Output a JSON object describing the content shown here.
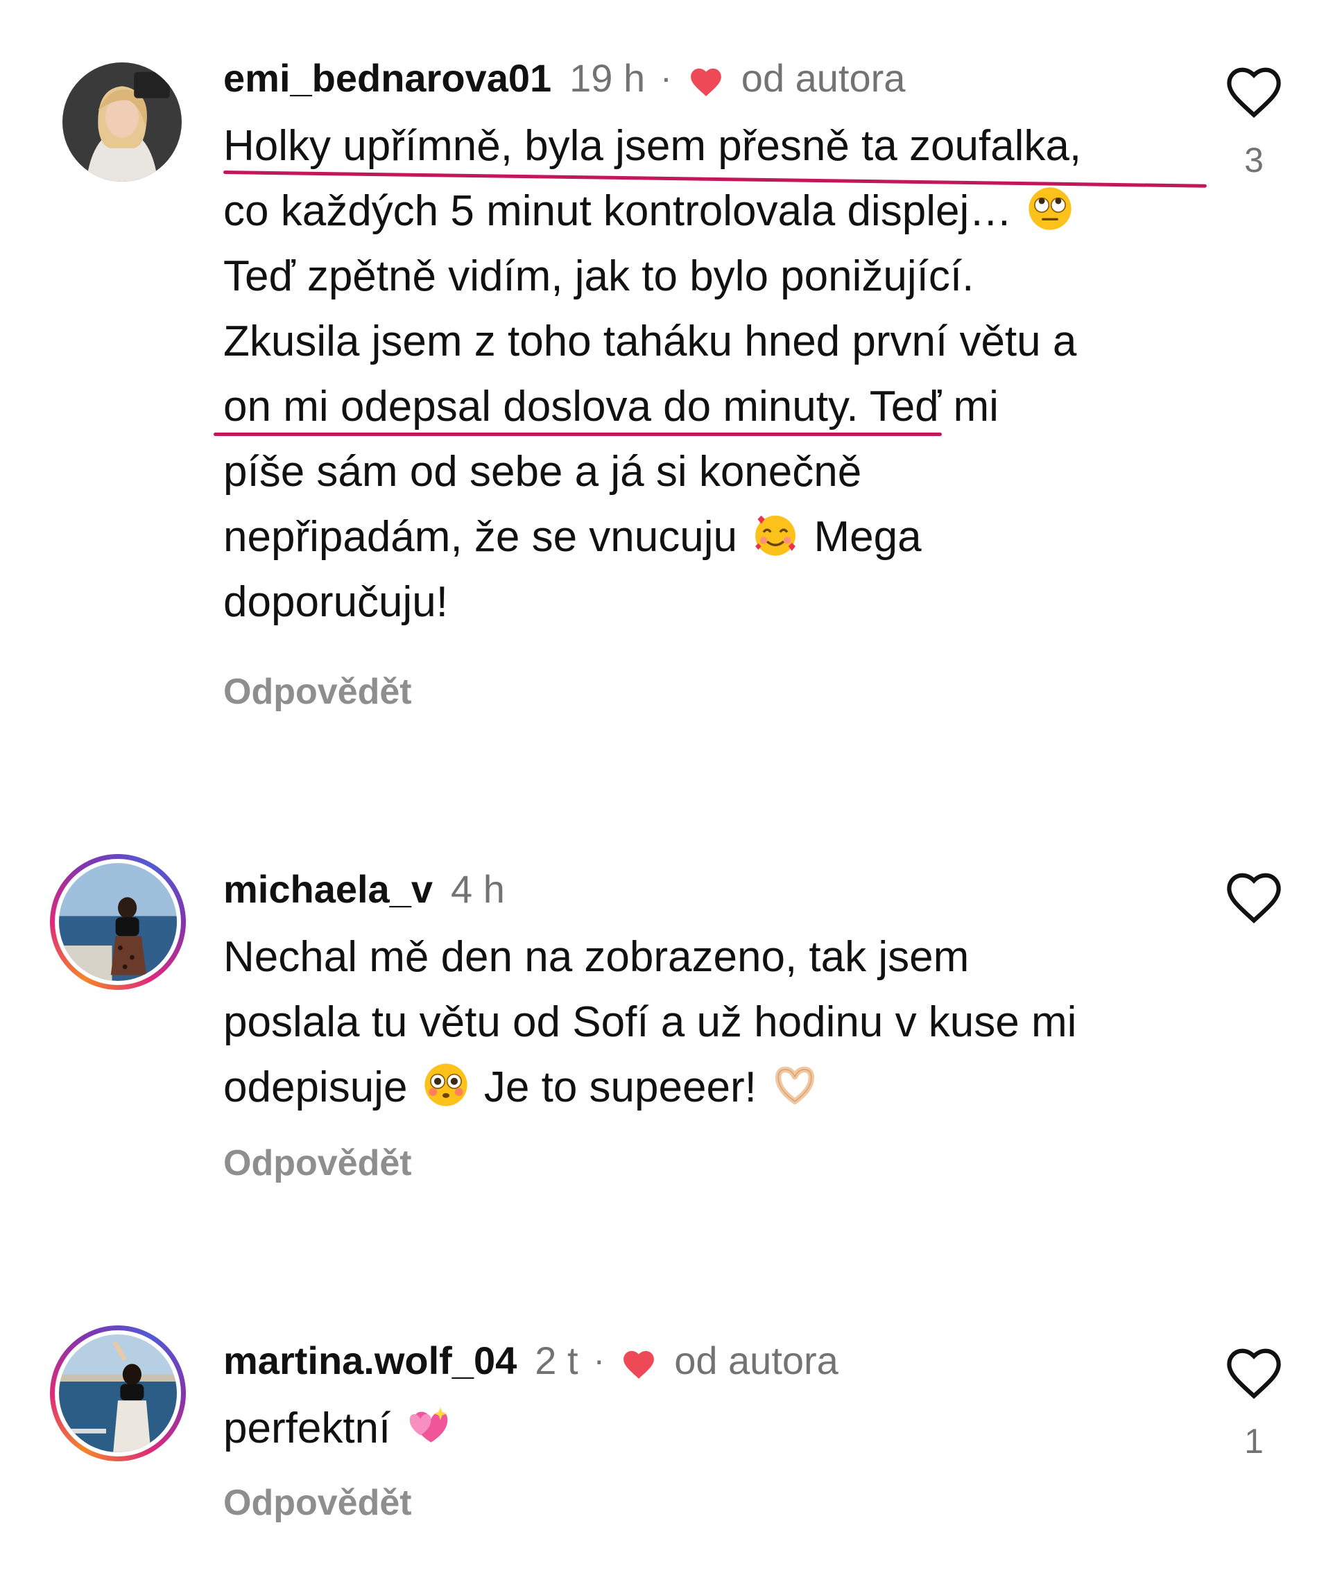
{
  "colors": {
    "username": "#111111",
    "muted": "#737373",
    "reply": "#8e8e8e",
    "heart": "#ed4956",
    "underline": "#c2185b"
  },
  "comments": [
    {
      "username": "emi_bednarova01",
      "time": "19 h",
      "separator": "·",
      "author_badge": "od autora",
      "author_heart_icon": "heart-filled-icon",
      "lines": [
        "Holky upřímně, byla jsem přesně ta zoufalka,",
        "co každých 5 minut kontrolovala displej…",
        "Teď zpětně vidím, jak to bylo ponižující.",
        "Zkusila jsem z toho taháku hned první větu a",
        "on mi odepsal doslova do minuty. Teď mi",
        "píše sám od sebe a já si konečně",
        "nepřipadám, že se vnucuju",
        "Mega",
        "doporučuju!"
      ],
      "emojis": [
        "eye-roll-emoji",
        "smiling-hearts-emoji"
      ],
      "reply_label": "Odpovědět",
      "like_count": "3"
    },
    {
      "username": "michaela_v",
      "time": "4 h",
      "lines": [
        "Nechal mě den na zobrazeno, tak jsem",
        "poslala tu větu od Sofí a už hodinu v kuse mi",
        "odepisuje",
        "Je to supeeer!"
      ],
      "emojis": [
        "flushed-emoji",
        "heart-hands-emoji"
      ],
      "reply_label": "Odpovědět",
      "like_count": ""
    },
    {
      "username": "martina.wolf_04",
      "time": "2 t",
      "separator": "·",
      "author_badge": "od autora",
      "author_heart_icon": "heart-filled-icon",
      "lines": [
        "perfektní"
      ],
      "emojis": [
        "sparkling-heart-emoji"
      ],
      "reply_label": "Odpovědět",
      "like_count": "1"
    }
  ]
}
